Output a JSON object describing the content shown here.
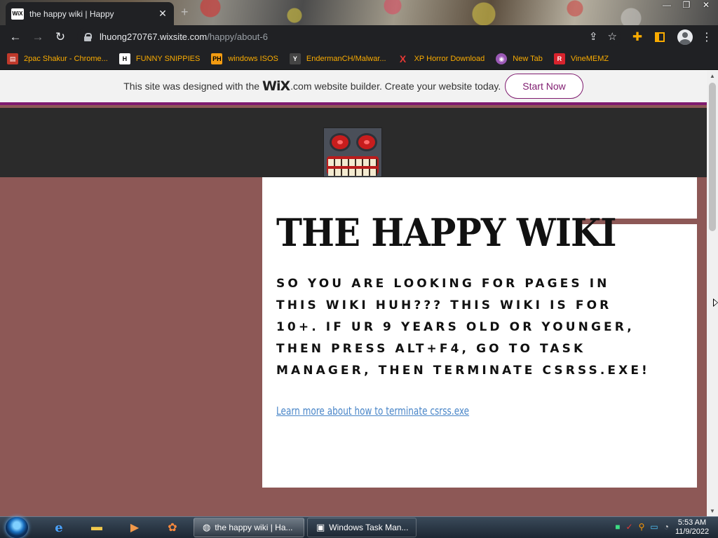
{
  "browser": {
    "tab_title": "the happy wiki | Happy",
    "tab_favicon": "WiX",
    "url_host": "lhuong270767.wixsite.com",
    "url_path": "/happy/about-6"
  },
  "bookmarks": [
    {
      "label": "2pac Shakur - Chrome...",
      "icon": "",
      "icon_bg": "#c0392b"
    },
    {
      "label": "FUNNY SNIPPIES",
      "icon": "H",
      "icon_bg": "#ffffff"
    },
    {
      "label": "windows ISOS",
      "icon": "PH",
      "icon_bg": "#f39c12"
    },
    {
      "label": "EndermanCH/Malwar...",
      "icon": "Y",
      "icon_bg": "#444444"
    },
    {
      "label": "XP Horror Download",
      "icon": "X",
      "icon_bg": "#202124"
    },
    {
      "label": "New Tab",
      "icon": "",
      "icon_bg": "#9b59b6"
    },
    {
      "label": "VineMEMZ",
      "icon": "R",
      "icon_bg": "#d9232d"
    }
  ],
  "wix_banner": {
    "prefix": "This site was designed with the",
    "logo": "WiX",
    "suffix": ".com website builder. Create your website today.",
    "button": "Start Now"
  },
  "page": {
    "title": "THE HAPPY WIKI",
    "body": "So you are looking for pages in this wiki huh??? This wiki is for 10+. If ur 9 years old or younger, then press Alt+F4, go to Task Manager, then terminate csrss.exe!",
    "link": "Learn more about how to terminate csrss.exe"
  },
  "taskbar": {
    "tasks": [
      {
        "label": "the happy wiki | Ha..."
      },
      {
        "label": "Windows Task Man..."
      }
    ],
    "time": "5:53 AM",
    "date": "11/9/2022"
  },
  "colors": {
    "page_bg": "#8d5856",
    "header_dark": "#2b2b2b",
    "wix_purple": "#7f1b6f",
    "link_blue": "#4a86c8",
    "bookmark_text": "#f9ab00"
  }
}
